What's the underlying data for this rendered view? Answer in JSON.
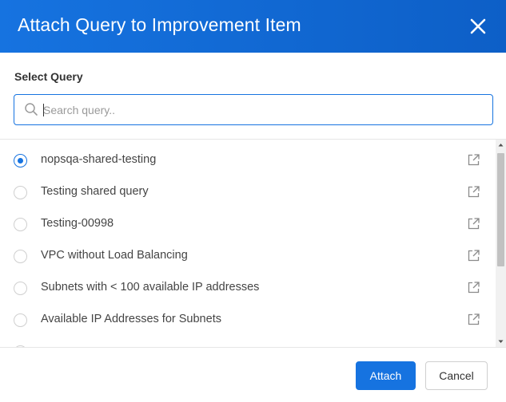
{
  "dialog": {
    "title": "Attach Query to Improvement Item",
    "close_icon": "close-icon"
  },
  "select_query": {
    "label": "Select Query",
    "search": {
      "placeholder": "Search query..",
      "value": "",
      "icon": "search-icon"
    }
  },
  "queries": [
    {
      "label": "nopsqa-shared-testing",
      "selected": true,
      "icon": "external-link-icon"
    },
    {
      "label": "Testing shared query",
      "selected": false,
      "icon": "external-link-icon"
    },
    {
      "label": "Testing-00998",
      "selected": false,
      "icon": "external-link-icon"
    },
    {
      "label": "VPC without Load Balancing",
      "selected": false,
      "icon": "external-link-icon"
    },
    {
      "label": "Subnets with < 100 available IP addresses",
      "selected": false,
      "icon": "external-link-icon"
    },
    {
      "label": "Available IP Addresses for Subnets",
      "selected": false,
      "icon": "external-link-icon"
    },
    {
      "label": "",
      "selected": false,
      "icon": "external-link-icon"
    }
  ],
  "footer": {
    "attach_label": "Attach",
    "cancel_label": "Cancel"
  },
  "colors": {
    "header_bg": "#1673e0",
    "accent": "#1673e0",
    "scrollbar_track": "#f1f1f1",
    "scrollbar_thumb": "#c1c1c1"
  }
}
